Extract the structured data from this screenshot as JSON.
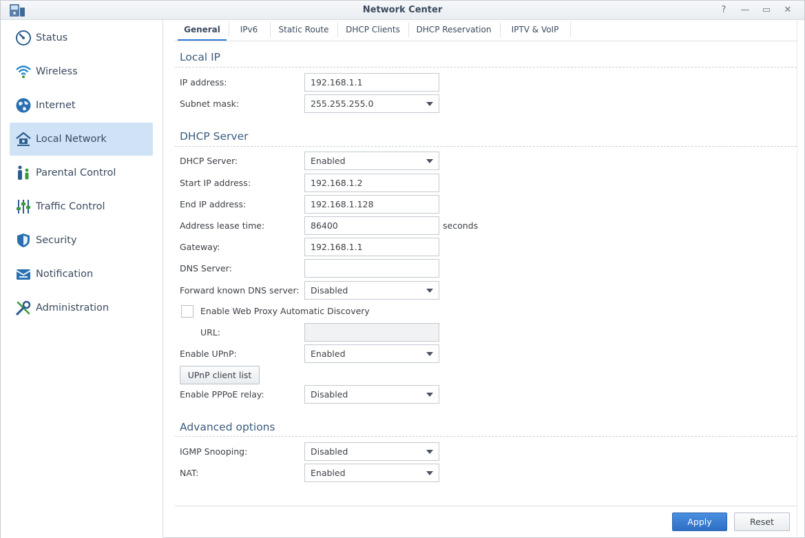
{
  "window": {
    "title": "Network Center",
    "help_glyph": "?",
    "minimize_glyph": "—",
    "maximize_glyph": "▭",
    "close_glyph": "✕"
  },
  "sidebar": {
    "items": [
      {
        "label": "Status",
        "icon": "gauge-icon",
        "active": false
      },
      {
        "label": "Wireless",
        "icon": "wifi-icon",
        "active": false
      },
      {
        "label": "Internet",
        "icon": "globe-icon",
        "active": false
      },
      {
        "label": "Local Network",
        "icon": "home-network-icon",
        "active": true
      },
      {
        "label": "Parental Control",
        "icon": "family-icon",
        "active": false
      },
      {
        "label": "Traffic Control",
        "icon": "sliders-icon",
        "active": false
      },
      {
        "label": "Security",
        "icon": "shield-icon",
        "active": false
      },
      {
        "label": "Notification",
        "icon": "envelope-icon",
        "active": false
      },
      {
        "label": "Administration",
        "icon": "wrench-icon",
        "active": false
      }
    ]
  },
  "tabs": [
    {
      "label": "General",
      "active": true
    },
    {
      "label": "IPv6",
      "active": false
    },
    {
      "label": "Static Route",
      "active": false
    },
    {
      "label": "DHCP Clients",
      "active": false
    },
    {
      "label": "DHCP Reservation",
      "active": false
    },
    {
      "label": "IPTV & VoIP",
      "active": false
    }
  ],
  "local_ip": {
    "title": "Local IP",
    "ip_label": "IP address:",
    "ip_value": "192.168.1.1",
    "mask_label": "Subnet mask:",
    "mask_value": "255.255.255.0"
  },
  "dhcp": {
    "title": "DHCP Server",
    "server_label": "DHCP Server:",
    "server_value": "Enabled",
    "start_label": "Start IP address:",
    "start_value": "192.168.1.2",
    "end_label": "End IP address:",
    "end_value": "192.168.1.128",
    "lease_label": "Address lease time:",
    "lease_value": "86400",
    "lease_unit": "seconds",
    "gateway_label": "Gateway:",
    "gateway_value": "192.168.1.1",
    "dns_label": "DNS Server:",
    "dns_value": "",
    "forward_label": "Forward known DNS server:",
    "forward_value": "Disabled",
    "wpad_label": "Enable Web Proxy Automatic Discovery",
    "wpad_checked": false,
    "url_label": "URL:",
    "url_value": "",
    "upnp_label": "Enable UPnP:",
    "upnp_value": "Enabled",
    "upnp_list_button": "UPnP client list",
    "pppoe_label": "Enable PPPoE relay:",
    "pppoe_value": "Disabled"
  },
  "advanced": {
    "title": "Advanced options",
    "igmp_label": "IGMP Snooping:",
    "igmp_value": "Disabled",
    "nat_label": "NAT:",
    "nat_value": "Enabled"
  },
  "footer": {
    "apply_label": "Apply",
    "reset_label": "Reset"
  },
  "colors": {
    "accent": "#2f7bd9",
    "active_item_bg": "#cfe2f6",
    "apply_bg": "#3a7fd5"
  }
}
